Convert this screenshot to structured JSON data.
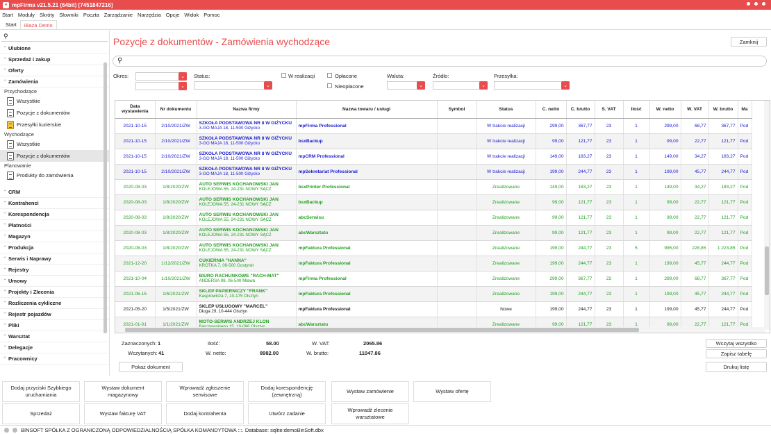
{
  "window": {
    "title": "mpFirma v21.5.21 (64bit) [7451847216]"
  },
  "menu": [
    "Start",
    "Moduły",
    "Skróty",
    "Słowniki",
    "Poczta",
    "Zarządzanie",
    "Narzędzia",
    "Opcje",
    "Widok",
    "Pomoc"
  ],
  "tabs": [
    "Start",
    "iBaza Demo"
  ],
  "sidebar": {
    "search_icon": "search-icon",
    "sections_top": [
      "Ulubione",
      "Sprzedaż i zakup",
      "Oferty",
      "Zamówienia"
    ],
    "groups": [
      {
        "label": "Przychodzące",
        "items": [
          "Wszystkie",
          "Pozycje z dokumentów",
          "Przesyłki kurierskie"
        ]
      },
      {
        "label": "Wychodzące",
        "items": [
          "Wszystkie",
          "Pozycje z dokumentów"
        ]
      },
      {
        "label": "Planowanie",
        "items": [
          "Produkty do zamówienia"
        ]
      }
    ],
    "sections_bottom": [
      "CRM",
      "Kontrahenci",
      "Korespondencja",
      "Płatności",
      "Magazyn",
      "Produkcja",
      "Serwis i Naprawy",
      "Rejestry",
      "Umowy",
      "Projekty i Zlecenia",
      "Rozliczenia cykliczne",
      "Rejestr pojazdów",
      "Pliki",
      "Warsztat",
      "Delegacje",
      "Pracownicy"
    ]
  },
  "page": {
    "title": "Pozycje z dokumentów - Zamówienia wychodzące",
    "close_label": "Zamknij",
    "filters": {
      "okres": "Okres:",
      "status": "Status:",
      "w_realizacji": "W realizacji",
      "oplacone": "Opłacone",
      "nieoplacone": "Nieopłacone",
      "waluta": "Waluta:",
      "zrodlo": "Źródło:",
      "przesylka": "Przesyłka:"
    }
  },
  "table": {
    "columns": [
      "Data wystawienia",
      "Nr dokumentu",
      "Nazwa firmy",
      "Nazwa towaru / usługi",
      "Symbol",
      "Status",
      "C. netto",
      "C. brutto",
      "S. VAT",
      "Ilość",
      "W. netto",
      "W. VAT",
      "W. brutto",
      "Ma"
    ],
    "rows": [
      {
        "date": "2021-10-15",
        "nr": "2/10/2021/ZW",
        "firm": "SZKOŁA PODSTAWOWA NR 8 W GIŻYCKU",
        "addr": "3-GO MAJA 18, 11-500 Giżycko",
        "product": "mpFirma Professional",
        "symbol": "",
        "status": "W trakcie realizacji",
        "cnetto": "299,00",
        "cbrutto": "367,77",
        "svat": "23",
        "ilosc": "1",
        "wnetto": "299,00",
        "wvat": "68,77",
        "wbrutto": "367,77",
        "ma": "Pod",
        "st": "wt"
      },
      {
        "date": "2021-10-15",
        "nr": "2/10/2021/ZW",
        "firm": "SZKOŁA PODSTAWOWA NR 8 W GIŻYCKU",
        "addr": "3-GO MAJA 18, 11-500 Giżycko",
        "product": "bsxBackup",
        "symbol": "",
        "status": "W trakcie realizacji",
        "cnetto": "99,00",
        "cbrutto": "121,77",
        "svat": "23",
        "ilosc": "1",
        "wnetto": "99,00",
        "wvat": "22,77",
        "wbrutto": "121,77",
        "ma": "Pod",
        "st": "wt"
      },
      {
        "date": "2021-10-15",
        "nr": "2/10/2021/ZW",
        "firm": "SZKOŁA PODSTAWOWA NR 8 W GIŻYCKU",
        "addr": "3-GO MAJA 18, 11-500 Giżycko",
        "product": "mpCRM Professional",
        "symbol": "",
        "status": "W trakcie realizacji",
        "cnetto": "149,00",
        "cbrutto": "183,27",
        "svat": "23",
        "ilosc": "1",
        "wnetto": "149,00",
        "wvat": "34,27",
        "wbrutto": "183,27",
        "ma": "Pod",
        "st": "wt"
      },
      {
        "date": "2021-10-15",
        "nr": "2/10/2021/ZW",
        "firm": "SZKOŁA PODSTAWOWA NR 8 W GIŻYCKU",
        "addr": "3-GO MAJA 18, 11-500 Giżycko",
        "product": "mpSekretariat Professional",
        "symbol": "",
        "status": "W trakcie realizacji",
        "cnetto": "199,00",
        "cbrutto": "244,77",
        "svat": "23",
        "ilosc": "1",
        "wnetto": "199,00",
        "wvat": "45,77",
        "wbrutto": "244,77",
        "ma": "Pod",
        "st": "wt"
      },
      {
        "date": "2020-08-03",
        "nr": "1/8/2020/ZW",
        "firm": "AUTO SERWIS KOCHANOWSKI JAN",
        "addr": "KOLEJOWA 55, 24-231 NOWY SĄCZ",
        "product": "bsxPrinter Professional",
        "symbol": "",
        "status": "Zrealizowane",
        "cnetto": "149,00",
        "cbrutto": "183,27",
        "svat": "23",
        "ilosc": "1",
        "wnetto": "149,00",
        "wvat": "34,27",
        "wbrutto": "183,27",
        "ma": "Pod",
        "st": "zr"
      },
      {
        "date": "2020-08-03",
        "nr": "1/8/2020/ZW",
        "firm": "AUTO SERWIS KOCHANOWSKI JAN",
        "addr": "KOLEJOWA 55, 24-231 NOWY SĄCZ",
        "product": "bsxBackup",
        "symbol": "",
        "status": "Zrealizowane",
        "cnetto": "99,00",
        "cbrutto": "121,77",
        "svat": "23",
        "ilosc": "1",
        "wnetto": "99,00",
        "wvat": "22,77",
        "wbrutto": "121,77",
        "ma": "Pod",
        "st": "zr"
      },
      {
        "date": "2020-08-03",
        "nr": "1/8/2020/ZW",
        "firm": "AUTO SERWIS KOCHANOWSKI JAN",
        "addr": "KOLEJOWA 55, 24-231 NOWY SĄCZ",
        "product": "abcSerwisu",
        "symbol": "",
        "status": "Zrealizowane",
        "cnetto": "99,00",
        "cbrutto": "121,77",
        "svat": "23",
        "ilosc": "1",
        "wnetto": "99,00",
        "wvat": "22,77",
        "wbrutto": "121,77",
        "ma": "Pod",
        "st": "zr"
      },
      {
        "date": "2020-08-03",
        "nr": "1/8/2020/ZW",
        "firm": "AUTO SERWIS KOCHANOWSKI JAN",
        "addr": "KOLEJOWA 55, 24-231 NOWY SĄCZ",
        "product": "abcWarsztatu",
        "symbol": "",
        "status": "Zrealizowane",
        "cnetto": "99,00",
        "cbrutto": "121,77",
        "svat": "23",
        "ilosc": "1",
        "wnetto": "99,00",
        "wvat": "22,77",
        "wbrutto": "121,77",
        "ma": "Pod",
        "st": "zr"
      },
      {
        "date": "2020-08-03",
        "nr": "1/8/2020/ZW",
        "firm": "AUTO SERWIS KOCHANOWSKI JAN",
        "addr": "KOLEJOWA 55, 24-231 NOWY SĄCZ",
        "product": "mpFaktura Professional",
        "symbol": "",
        "status": "Zrealizowane",
        "cnetto": "199,00",
        "cbrutto": "244,77",
        "svat": "23",
        "ilosc": "5",
        "wnetto": "995,00",
        "wvat": "228,85",
        "wbrutto": "1 223,85",
        "ma": "Pod",
        "st": "zr"
      },
      {
        "date": "2021-12-20",
        "nr": "1/12/2021/ZW",
        "firm": "CUKIERNIA \"HANNA\"",
        "addr": "KRÓTKA 7, 09-500 Gostynin",
        "product": "mpFaktura Professional",
        "symbol": "",
        "status": "Zrealizowane",
        "cnetto": "199,00",
        "cbrutto": "244,77",
        "svat": "23",
        "ilosc": "1",
        "wnetto": "199,00",
        "wvat": "45,77",
        "wbrutto": "244,77",
        "ma": "Pod",
        "st": "zr"
      },
      {
        "date": "2021-10-04",
        "nr": "1/10/2021/ZW",
        "firm": "BIURO RACHUNKOWE \"RACH-MAT\"",
        "addr": "ANDERSA 98, 06-500 Mława",
        "product": "mpFirma Professional",
        "symbol": "",
        "status": "Zrealizowane",
        "cnetto": "299,00",
        "cbrutto": "367,77",
        "svat": "23",
        "ilosc": "1",
        "wnetto": "299,00",
        "wvat": "68,77",
        "wbrutto": "367,77",
        "ma": "Pod",
        "st": "zr"
      },
      {
        "date": "2021-06-15",
        "nr": "1/6/2021/ZW",
        "firm": "SKLEP PAPIERNICZY \"FRANK\"",
        "addr": "Kasprowicza 7, 10-175 Olsztyn",
        "product": "mpFaktura Professional",
        "symbol": "",
        "status": "Zrealizowane",
        "cnetto": "199,00",
        "cbrutto": "244,77",
        "svat": "23",
        "ilosc": "1",
        "wnetto": "199,00",
        "wvat": "45,77",
        "wbrutto": "244,77",
        "ma": "Pod",
        "st": "zr"
      },
      {
        "date": "2021-05-20",
        "nr": "1/5/2021/ZW",
        "firm": "SKLEP USŁUGOWY \"MARCEL\"",
        "addr": "Długa 29, 10-444 Olsztyn",
        "product": "mpFaktura Professional",
        "symbol": "",
        "status": "Nowe",
        "cnetto": "199,00",
        "cbrutto": "244,77",
        "svat": "23",
        "ilosc": "1",
        "wnetto": "199,00",
        "wvat": "45,77",
        "wbrutto": "244,77",
        "ma": "Pod",
        "st": "nw"
      },
      {
        "date": "2021-01-01",
        "nr": "1/1/2021/ZW",
        "firm": "MOTO-SERWIS ANDRZEJ KLON",
        "addr": "Barczewskiego 15, 10-086 Olsztyn",
        "product": "abcWarsztatu",
        "symbol": "",
        "status": "Zrealizowane",
        "cnetto": "99,00",
        "cbrutto": "121,77",
        "svat": "23",
        "ilosc": "1",
        "wnetto": "99,00",
        "wvat": "22,77",
        "wbrutto": "121,77",
        "ma": "Pod",
        "st": "zr"
      }
    ]
  },
  "summary": {
    "zaznaczonych_label": "Zaznaczonych:",
    "zaznaczonych": "1",
    "wczytanych_label": "Wczytanych:",
    "wczytanych": "41",
    "ilosc_label": "Ilość:",
    "ilosc": "58.00",
    "wnetto_label": "W. netto:",
    "wnetto": "8982.00",
    "wvat_label": "W. VAT:",
    "wvat": "2065.86",
    "wbrutto_label": "W. brutto:",
    "wbrutto": "11047.86"
  },
  "actions": {
    "pokaz_dokument": "Pokaż dokument",
    "wczytaj_wszystko": "Wczytaj wszystko",
    "zapisz_tabele": "Zapisz tabelę",
    "drukuj_liste": "Drukuj listę"
  },
  "quick_buttons": [
    "Dodaj przyciski Szybkiego uruchamiania",
    "Wystaw dokument magazynowy",
    "Wprowadź zgłoszenie serwisowe",
    "Dodaj korespondencję (zewnętrzną)",
    "Wystaw zamówienie",
    "Wystaw ofertę",
    "Sprzedaż",
    "Wystaw fakturę VAT",
    "Dodaj kontrahenta",
    "Utwórz zadanie",
    "Wprowadź zlecenie warsztatowe"
  ],
  "status": {
    "text": "BINSOFT SPÓŁKA Z OGRANICZONĄ ODPOWIEDZIALNOŚCIĄ SPÓŁKA KOMANDYTOWA :::. Database: sqlite:demoBinSoft.dbx"
  },
  "colors": {
    "accent": "#e84c4c",
    "status_in_progress": "#1a1ad0",
    "status_done": "#1f9e1f"
  }
}
